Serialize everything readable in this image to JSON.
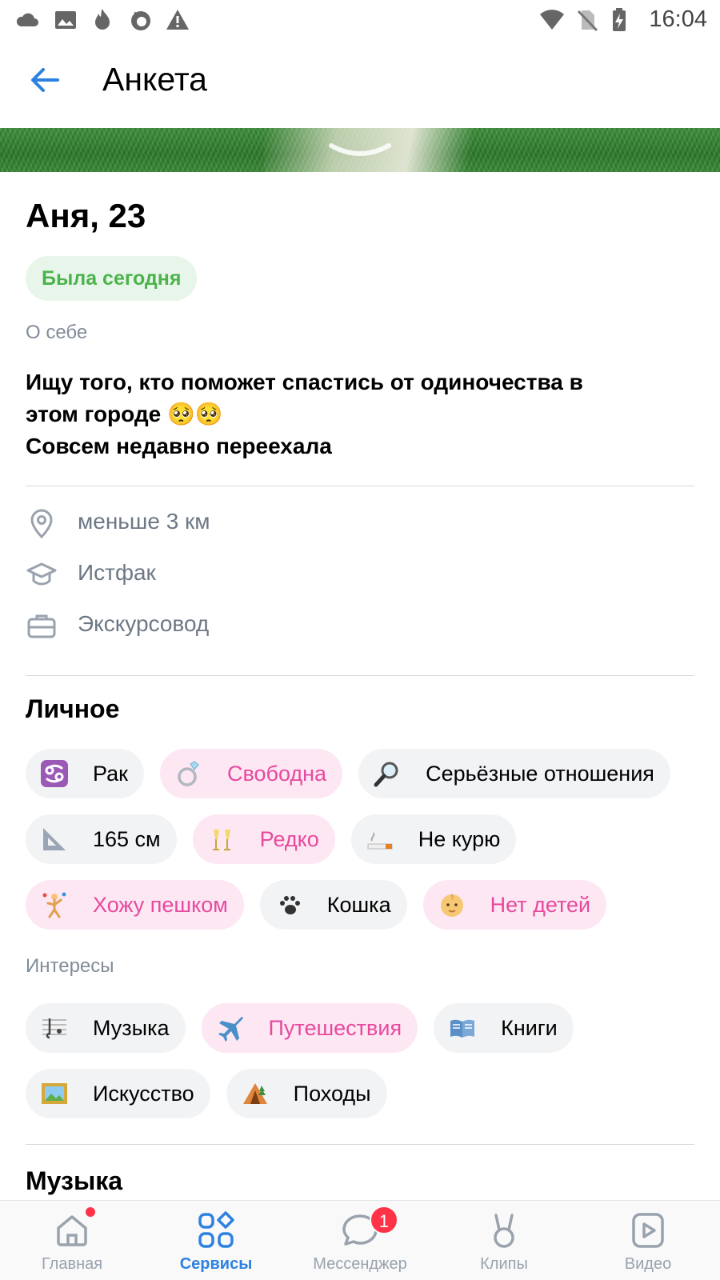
{
  "status_bar": {
    "time": "16:04",
    "left_icons": [
      "cloud-icon",
      "image-icon",
      "fire-icon",
      "firefox-icon",
      "warning-icon"
    ],
    "right_icons": [
      "wifi-icon",
      "no-sim-icon",
      "battery-charging-icon"
    ]
  },
  "header": {
    "title": "Анкета"
  },
  "profile": {
    "name": "Аня, 23",
    "status": "Была сегодня",
    "about_label": "О себе",
    "about_line1": "Ищу того, кто поможет спастись от одиночества в",
    "about_line2": "этом городе 🥺🥺",
    "about_line3": "Совсем недавно переехала",
    "distance": "меньше 3 км",
    "education": "Истфак",
    "job": "Экскурсовод"
  },
  "personal": {
    "title": "Личное",
    "chips": [
      {
        "label": "Рак",
        "icon": "cancer-zodiac-icon",
        "pink": false
      },
      {
        "label": "Свободна",
        "icon": "ring-icon",
        "pink": true
      },
      {
        "label": "Серьёзные отношения",
        "icon": "magnifier-icon",
        "pink": false
      },
      {
        "label": "165 см",
        "icon": "triangle-ruler-icon",
        "pink": false
      },
      {
        "label": "Редко",
        "icon": "champagne-icon",
        "pink": true
      },
      {
        "label": "Не курю",
        "icon": "cigarette-icon",
        "pink": false
      },
      {
        "label": "Хожу пешком",
        "icon": "juggler-icon",
        "pink": true
      },
      {
        "label": "Кошка",
        "icon": "paw-icon",
        "pink": false
      },
      {
        "label": "Нет детей",
        "icon": "baby-icon",
        "pink": true
      }
    ]
  },
  "interests": {
    "label": "Интересы",
    "chips": [
      {
        "label": "Музыка",
        "icon": "music-score-icon",
        "pink": false
      },
      {
        "label": "Путешествия",
        "icon": "airplane-icon",
        "pink": true
      },
      {
        "label": "Книги",
        "icon": "book-icon",
        "pink": false
      },
      {
        "label": "Искусство",
        "icon": "framed-picture-icon",
        "pink": false
      },
      {
        "label": "Походы",
        "icon": "tent-icon",
        "pink": false
      }
    ]
  },
  "music": {
    "title": "Музыка"
  },
  "bottom_nav": {
    "items": [
      {
        "label": "Главная",
        "icon": "home-icon"
      },
      {
        "label": "Сервисы",
        "icon": "services-icon"
      },
      {
        "label": "Мессенджер",
        "icon": "messenger-icon",
        "badge": "1"
      },
      {
        "label": "Клипы",
        "icon": "clips-icon"
      },
      {
        "label": "Видео",
        "icon": "video-icon"
      }
    ]
  },
  "colors": {
    "accent": "#2d81e0",
    "online_green": "#4bb34b",
    "pink": "#e64a9e",
    "badge_red": "#ff3347"
  }
}
